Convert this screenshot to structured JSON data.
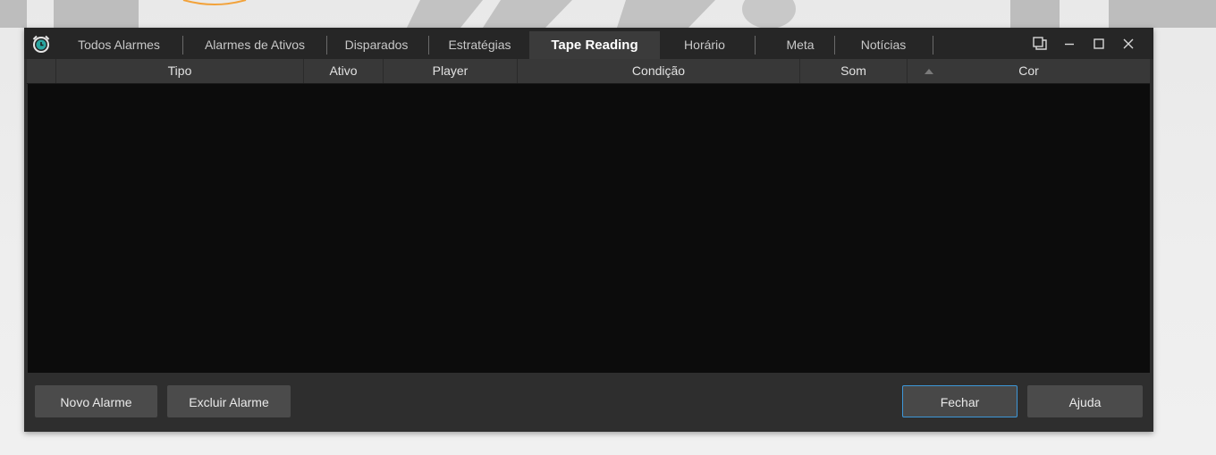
{
  "window": {
    "tabs": [
      {
        "label": "Todos Alarmes"
      },
      {
        "label": "Alarmes de Ativos"
      },
      {
        "label": "Disparados"
      },
      {
        "label": "Estratégias"
      },
      {
        "label": "Tape Reading",
        "active": true
      },
      {
        "label": "Horário"
      },
      {
        "label": "Meta"
      },
      {
        "label": "Notícias"
      }
    ],
    "controls": [
      "restore-window-icon",
      "minimize-icon",
      "maximize-icon",
      "close-icon"
    ]
  },
  "table": {
    "columns": [
      "Tipo",
      "Ativo",
      "Player",
      "Condição",
      "Som",
      "Cor"
    ],
    "sort_indicator": "sort-ascending-icon",
    "rows": []
  },
  "footer": {
    "new_alarm": "Novo Alarme",
    "delete_alarm": "Excluir Alarme",
    "close": "Fechar",
    "help": "Ajuda"
  },
  "colors": {
    "tabbar_bg": "#262626",
    "active_tab_bg": "#3b3b3b",
    "grid_bg": "#0c0c0c",
    "button_bg": "#4b4b4b",
    "focus_border": "#3d97d8",
    "icon_accent": "#2aa5a0"
  }
}
